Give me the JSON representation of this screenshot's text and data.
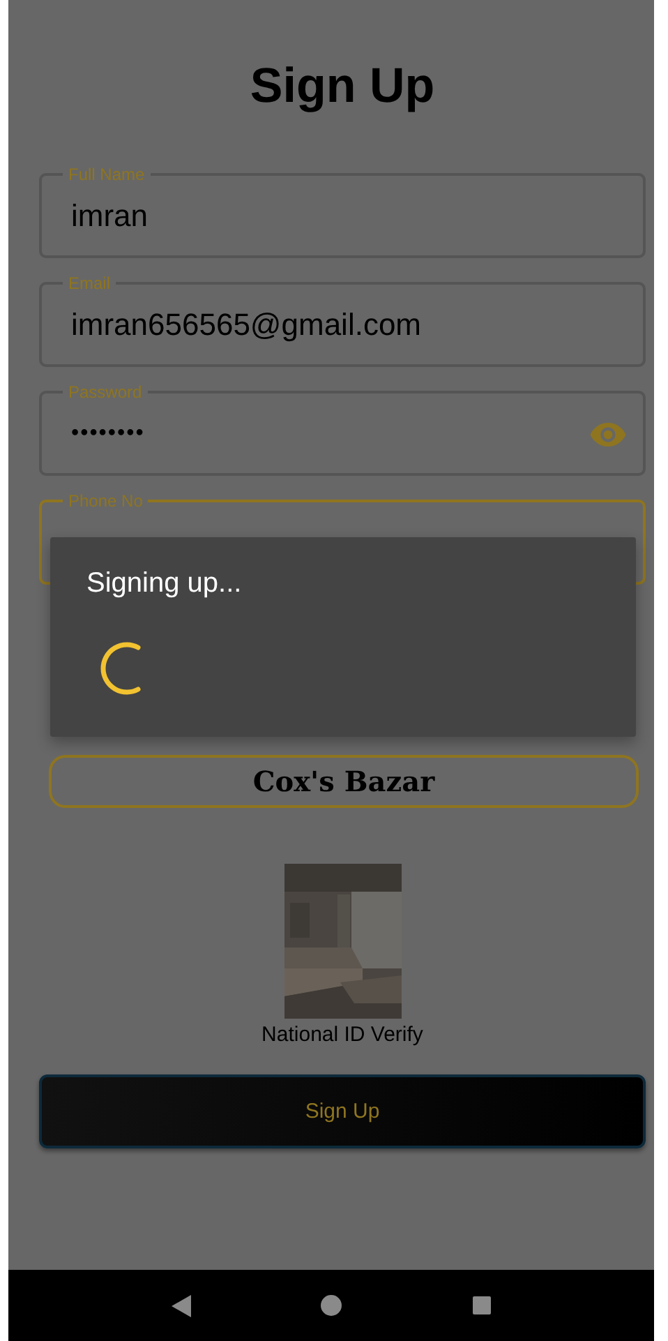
{
  "title": "Sign Up",
  "fields": [
    {
      "label": "Full Name",
      "value": "imran",
      "kind": "text",
      "focused": false
    },
    {
      "label": "Email",
      "value": "imran656565@gmail.com",
      "kind": "text",
      "focused": false
    },
    {
      "label": "Password",
      "value": "••••••••",
      "kind": "password",
      "focused": false
    },
    {
      "label": "Phone No",
      "kind": "text",
      "focused": true
    }
  ],
  "district": {
    "value": "Cox's Bazar"
  },
  "id_photo": {
    "kind": "picture",
    "caption": "National ID Verify"
  },
  "submit": {
    "label": "Sign Up"
  },
  "dialog": {
    "message": "Signing up..."
  }
}
